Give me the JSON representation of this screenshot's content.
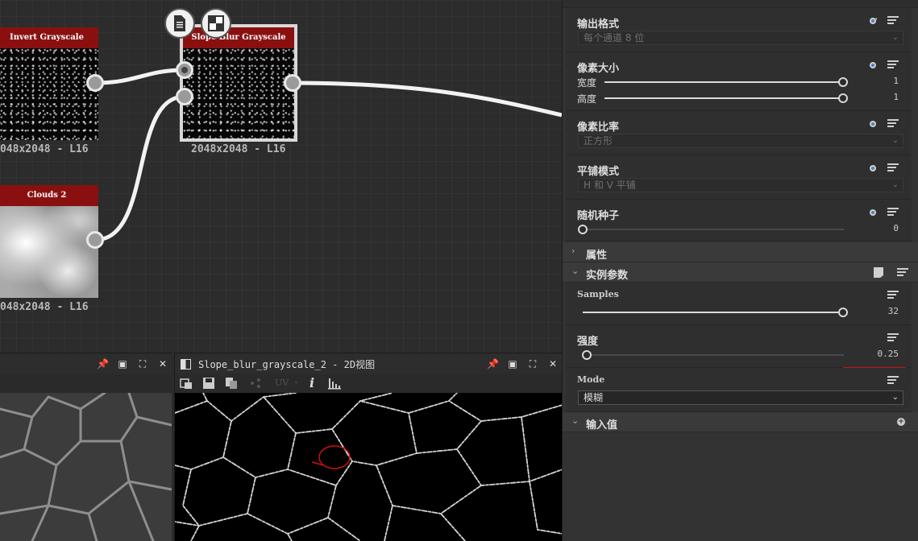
{
  "graph": {
    "nodes": [
      {
        "title": "Invert Grayscale",
        "caption": "048x2048 - L16"
      },
      {
        "title": "Slope Blur Grayscale",
        "caption": "2048x2048 - L16"
      },
      {
        "title": "Clouds 2",
        "caption": "048x2048 - L16"
      }
    ],
    "node_buttons": [
      "document-icon",
      "checker-icon"
    ]
  },
  "view_left": {
    "icons": [
      "pin-icon",
      "restore-icon",
      "maximize-icon",
      "close-icon"
    ]
  },
  "view_right": {
    "title": "Slope_blur_grayscale_2 - 2D视图",
    "toolbar": {
      "uv_label": "UV",
      "info_label": "i"
    },
    "icons": [
      "pin-icon",
      "restore-icon",
      "maximize-icon",
      "close-icon"
    ]
  },
  "panel": {
    "output_format": {
      "title": "输出格式",
      "value": "每个通道 8 位"
    },
    "pixel_size": {
      "title": "像素大小",
      "width_label": "宽度",
      "width_value": "1",
      "width_level": 1.0,
      "height_label": "高度",
      "height_value": "1",
      "height_level": 1.0
    },
    "pixel_ratio": {
      "title": "像素比率",
      "value": "正方形"
    },
    "tiling": {
      "title": "平铺模式",
      "value": "H 和 V 平铺"
    },
    "seed": {
      "title": "随机种子",
      "value": "0",
      "level": 0.0
    },
    "group_properties": "属性",
    "group_instance": "实例参数",
    "samples": {
      "title": "Samples",
      "value": "32",
      "level": 1.0
    },
    "intensity": {
      "title": "强度",
      "value": "0.25",
      "level": 0.0
    },
    "mode": {
      "title": "Mode",
      "value": "模糊"
    },
    "group_inputs": "输入值"
  },
  "colors": {
    "node_header": "#8a1010",
    "panel_bg": "#333333",
    "annotation": "#cc1111"
  }
}
